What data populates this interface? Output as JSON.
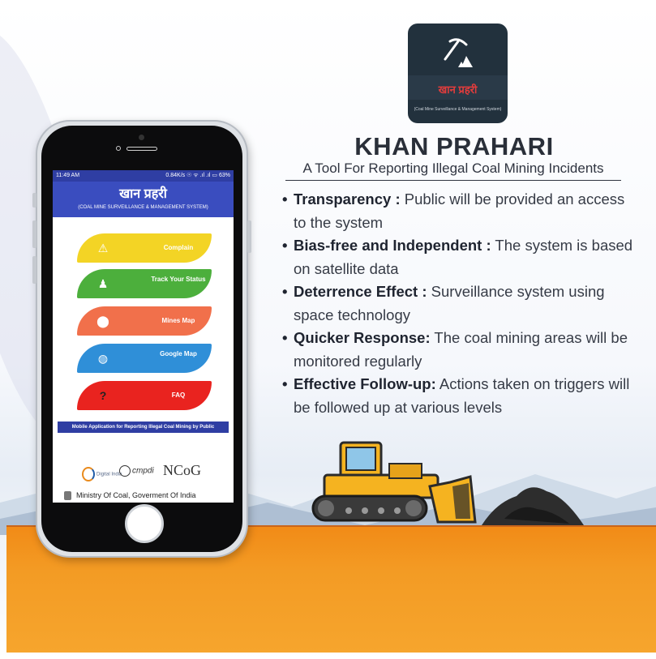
{
  "logo": {
    "title": "खान प्रहरी",
    "subtitle": "(Coal Mine Surveillance & Management System)",
    "icon": "pickaxe-coal-icon"
  },
  "headline": {
    "title": "KHAN PRAHARI",
    "subtitle": "A Tool For Reporting Illegal Coal Mining Incidents"
  },
  "bullets": [
    {
      "label": "Transparency :",
      "text": " Public will be provided an access to the system"
    },
    {
      "label": "Bias-free and Independent :",
      "text": " The system is based on satellite data"
    },
    {
      "label": "Deterrence Effect :",
      "text": " Surveillance system using space technology"
    },
    {
      "label": "Quicker Response:",
      "text": " The coal mining areas will be monitored regularly"
    },
    {
      "label": "Effective Follow-up:",
      "text": " Actions taken on triggers will be followed up at various levels"
    }
  ],
  "phone": {
    "status_bar": {
      "time": "11:49 AM",
      "info": "0.84K/s ☉ ᯤ .ıl .ıl ▭ 63%"
    },
    "app_title": "खान प्रहरी",
    "app_subtitle": "(COAL MINE SURVEILLANCE & MANAGEMENT SYSTEM)",
    "menu": [
      {
        "label": "Complain",
        "icon": "warning-icon",
        "color": "#f3d425"
      },
      {
        "label": "Track Your Status",
        "icon": "person-at-desk-icon",
        "color": "#4caf3c"
      },
      {
        "label": "Mines Map",
        "icon": "map-pin-icon",
        "color": "#f1704b"
      },
      {
        "label": "Google Map",
        "icon": "globe-icon",
        "color": "#2f8fd8"
      },
      {
        "label": "FAQ",
        "icon": "question-icon",
        "color": "#e9231f"
      }
    ],
    "footer_banner": "Mobile Application for Reporting Illegal Coal Mining by Public",
    "partners": {
      "digital_india": "Digital India",
      "cmpdi": "cmpdi",
      "ncog": "NCoG"
    },
    "ministry": "Ministry Of Coal, Goverment Of India"
  },
  "colors": {
    "app_blue": "#3a4dbf",
    "ground_orange": "#f39b24",
    "title_dark": "#2a2f39"
  }
}
